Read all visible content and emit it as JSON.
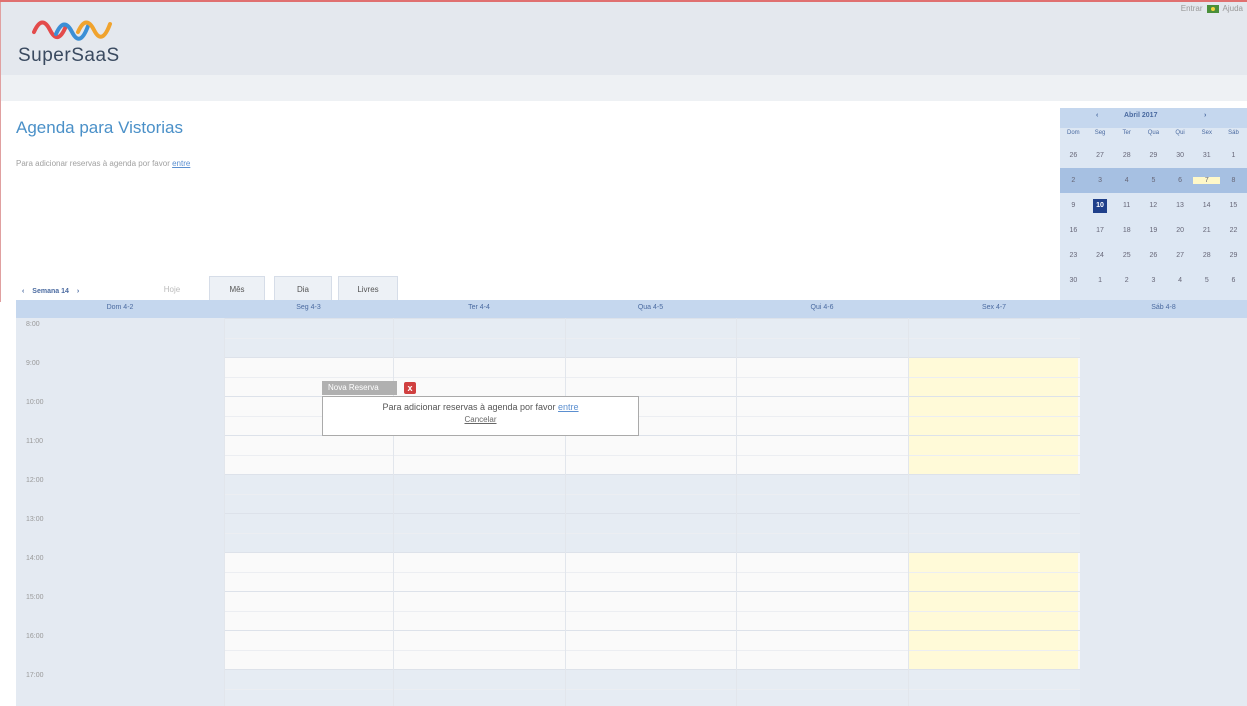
{
  "header": {
    "logo_text": "SuperSaaS",
    "toplinks": {
      "enter": "Entrar",
      "help": "Ajuda"
    }
  },
  "page": {
    "title": "Agenda para Vistorias",
    "intro_text": "Para adicionar reservas à agenda por favor ",
    "intro_link": "entre"
  },
  "calendar_tabs": {
    "nav_label": "Semana 14",
    "prev": "‹",
    "next": "›",
    "tabs": [
      "Hoje",
      "Mês",
      "Dia",
      "Livres"
    ]
  },
  "minical": {
    "prev": "‹",
    "title": "Abril 2017",
    "next": "›",
    "dow": [
      "Dom",
      "Seg",
      "Ter",
      "Qua",
      "Qui",
      "Sex",
      "Sáb"
    ],
    "weeks": [
      [
        "26",
        "27",
        "28",
        "29",
        "30",
        "31",
        "1"
      ],
      [
        "2",
        "3",
        "4",
        "5",
        "6",
        "7",
        "8"
      ],
      [
        "9",
        "10",
        "11",
        "12",
        "13",
        "14",
        "15"
      ],
      [
        "16",
        "17",
        "18",
        "19",
        "20",
        "21",
        "22"
      ],
      [
        "23",
        "24",
        "25",
        "26",
        "27",
        "28",
        "29"
      ],
      [
        "30",
        "1",
        "2",
        "3",
        "4",
        "5",
        "6"
      ]
    ],
    "today": "10"
  },
  "week": {
    "days": [
      "Dom 4-2",
      "Seg 4-3",
      "Ter 4-4",
      "Qua 4-5",
      "Qui 4-6",
      "Sex 4-7",
      "Sáb 4-8"
    ],
    "hours": [
      "8:00",
      "9:00",
      "10:00",
      "11:00",
      "12:00",
      "13:00",
      "14:00",
      "15:00",
      "16:00",
      "17:00"
    ]
  },
  "popup": {
    "title": "Nova Reserva",
    "close": "x",
    "message": "Para adicionar reservas à agenda por favor ",
    "link": "entre",
    "cancel": "Cancelar"
  },
  "colors": {
    "accent": "#4a90c8",
    "header_bg": "#e4e8ee",
    "closed_bg": "#e6ecf3",
    "friday_highlight": "#fffad8",
    "today_bg": "#1f3f8a"
  }
}
